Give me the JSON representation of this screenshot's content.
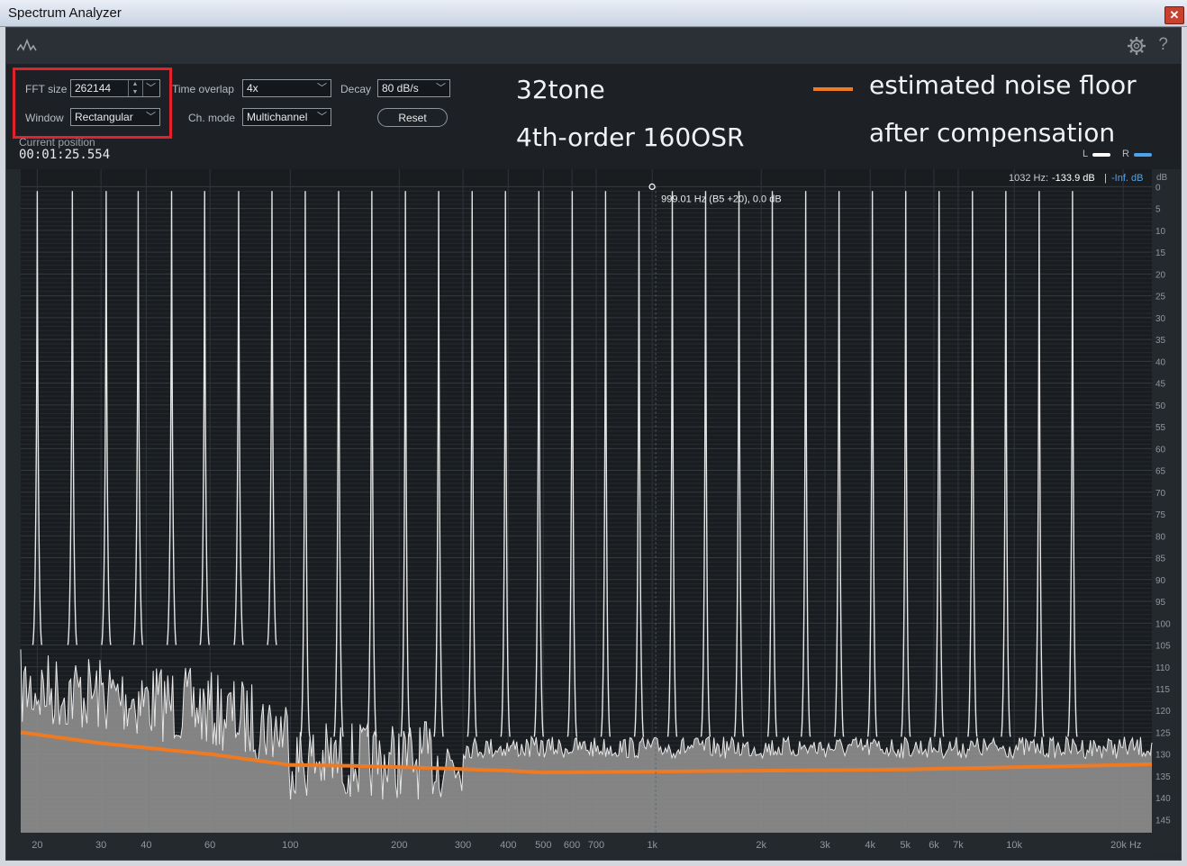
{
  "window": {
    "title": "Spectrum Analyzer",
    "close_glyph": "✕"
  },
  "toolbar": {
    "help_glyph": "?",
    "icons": [
      "waveform-icon",
      "gear-icon",
      "help-icon"
    ]
  },
  "controls": {
    "fft_size": {
      "label": "FFT size",
      "value": "262144"
    },
    "window": {
      "label": "Window",
      "value": "Rectangular"
    },
    "time_overlap": {
      "label": "Time overlap",
      "value": "4x"
    },
    "ch_mode": {
      "label": "Ch. mode",
      "value": "Multichannel"
    },
    "decay": {
      "label": "Decay",
      "value": "80 dB/s"
    },
    "reset_label": "Reset",
    "position_label": "Current position",
    "position_value": "00:01:25.554"
  },
  "annotations": {
    "line1": "32tone",
    "line2": "4th-order 160OSR",
    "legend1": "estimated noise floor",
    "legend2": "after compensation"
  },
  "channels": {
    "left": "L",
    "right": "R",
    "left_color": "#ffffff",
    "right_color": "#4aa3f0"
  },
  "readout": {
    "cursor_text": "1032 Hz:",
    "cursor_value": "-133.9 dB",
    "separator": "|",
    "right_value": "-Inf. dB",
    "peak_label": "999.01 Hz (B5 +20), 0.0 dB"
  },
  "colors": {
    "noise_floor": "#f07a22",
    "highlight": "#e3212b",
    "spectrum": "#e6e6e6",
    "background": "#1a1d20"
  },
  "chart_data": {
    "type": "line",
    "x_scale": "log",
    "xlim": [
      18,
      24000
    ],
    "ylim": [
      -148,
      4
    ],
    "x_tick_labels": [
      "20",
      "30",
      "40",
      "60",
      "100",
      "200",
      "300",
      "400",
      "500",
      "600",
      "700",
      "1k",
      "2k",
      "3k",
      "4k",
      "5k",
      "6k",
      "7k",
      "10k",
      "20k Hz"
    ],
    "x_tick_values": [
      20,
      30,
      40,
      60,
      100,
      200,
      300,
      400,
      500,
      600,
      700,
      1000,
      2000,
      3000,
      4000,
      5000,
      6000,
      7000,
      10000,
      20000
    ],
    "y_unit": "dB",
    "y_tick_labels": [
      "0",
      "5",
      "10",
      "15",
      "20",
      "25",
      "30",
      "35",
      "40",
      "45",
      "50",
      "55",
      "60",
      "65",
      "70",
      "75",
      "80",
      "85",
      "90",
      "95",
      "100",
      "105",
      "110",
      "115",
      "120",
      "125",
      "130",
      "135",
      "140",
      "145"
    ],
    "tones_hz": [
      20,
      25,
      31,
      38,
      47,
      58,
      72,
      89,
      110,
      136,
      168,
      208,
      257,
      318,
      393,
      486,
      601,
      743,
      919,
      1136,
      1404,
      1736,
      2146,
      2654,
      3281,
      4056,
      5015,
      6200,
      7666,
      9478,
      11718,
      14487
    ],
    "tone_level_db": -1,
    "series": [
      {
        "name": "estimated noise floor",
        "x": [
          18,
          30,
          60,
          100,
          150,
          250,
          400,
          500,
          1000,
          2000,
          5000,
          10000,
          20000,
          24000
        ],
        "y": [
          -125,
          -127.5,
          -130,
          -132.5,
          -132.7,
          -133.2,
          -133.8,
          -134.2,
          -134,
          -133.8,
          -133.5,
          -133,
          -132.5,
          -132.3
        ]
      }
    ]
  }
}
